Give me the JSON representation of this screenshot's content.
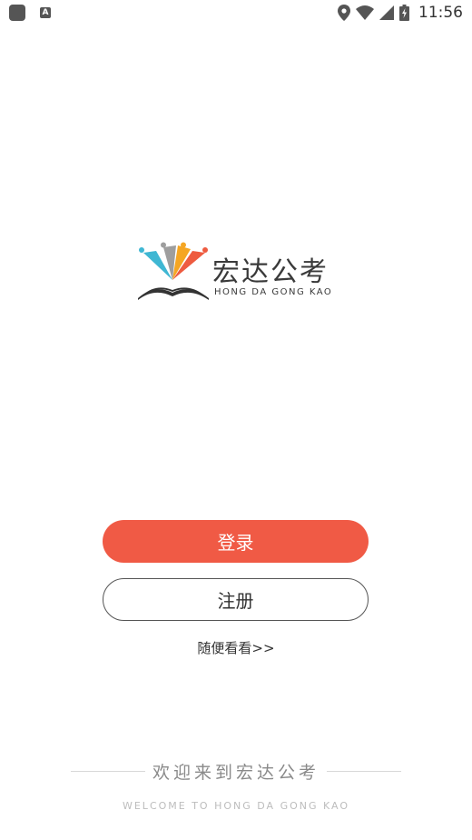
{
  "status_bar": {
    "time": "11:56",
    "left_icons": [
      "app-square-icon",
      "a-notification-icon"
    ],
    "right_icons": [
      "location-icon",
      "wifi-icon",
      "signal-icon",
      "battery-icon"
    ],
    "notification_letter": "A"
  },
  "logo": {
    "title": "宏达公考",
    "subtitle": "HONG DA GONG KAO",
    "colors": {
      "cyan": "#3fb7d3",
      "gray": "#9e9e9e",
      "orange": "#f5a623",
      "red": "#ee5b40",
      "book": "#333333"
    }
  },
  "actions": {
    "login_label": "登录",
    "register_label": "注册",
    "browse_label": "随便看看>>"
  },
  "footer": {
    "welcome_text": "欢迎来到宏达公考",
    "welcome_en": "WELCOME TO HONG DA GONG KAO"
  },
  "colors": {
    "accent": "#f05a45",
    "text": "#333333",
    "muted": "#8a8a8a"
  }
}
